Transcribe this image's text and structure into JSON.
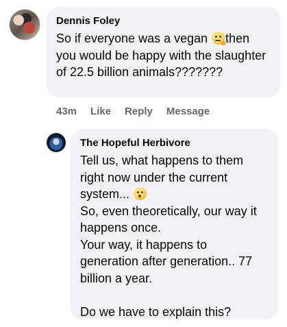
{
  "comments": [
    {
      "author": "Dennis Foley",
      "text_a": "So if everyone was a vegan ",
      "emoji_1": "thinking-face-emoji",
      "text_b": "then you would be happy with the slaughter of 22.5 billion animals???????",
      "actions": {
        "time": "43m",
        "like": "Like",
        "reply": "Reply",
        "message": "Message"
      }
    },
    {
      "author": "The Hopeful Herbivore",
      "text_a": "Tell us, what happens to them right now under the current system... ",
      "emoji_1": "flushed-face-emoji",
      "text_b": "\nSo, even theoretically, our way it happens once.\nYour way, it happens to generation after generation.. 77 billion a year.\n\nDo we have to explain this?"
    }
  ]
}
